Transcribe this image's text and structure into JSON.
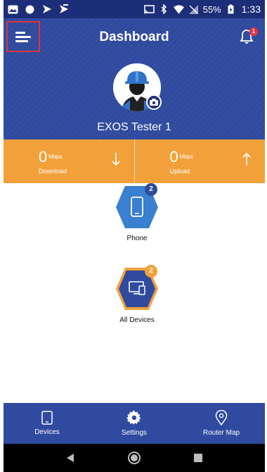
{
  "status_bar": {
    "battery": "55%",
    "time": "1:33"
  },
  "header": {
    "title": "Dashboard",
    "notification_count": "1"
  },
  "profile": {
    "name": "EXOS Tester 1"
  },
  "speed": {
    "download": {
      "value": "0",
      "unit": "Mbps",
      "label": "Download"
    },
    "upload": {
      "value": "0",
      "unit": "Mbps",
      "label": "Upload"
    }
  },
  "hex_items": [
    {
      "label": "Phone",
      "badge": "2",
      "badge_color": "#2f4a9e",
      "fill": "#3a7fd0"
    },
    {
      "label": "All Devices",
      "badge": "2",
      "badge_color": "#f2a13a",
      "fill": "#2f4a9e"
    }
  ],
  "bottom_nav": [
    {
      "label": "Devices"
    },
    {
      "label": "Settings"
    },
    {
      "label": "Router Map"
    }
  ],
  "colors": {
    "primary": "#2f4a9e",
    "accent": "#f2a13a",
    "highlight": "#e0343c"
  }
}
